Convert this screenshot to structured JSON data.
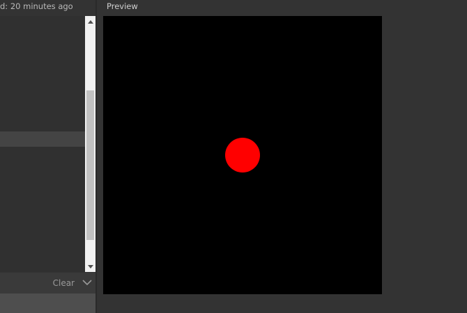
{
  "editor": {
    "saved_status": "d: 20 minutes ago"
  },
  "console": {
    "clear_label": "Clear",
    "toggle_icon": "chevron-down-icon"
  },
  "preview": {
    "label": "Preview",
    "background_color": "#000000",
    "shape": {
      "type": "circle",
      "color": "#ff0000"
    }
  }
}
